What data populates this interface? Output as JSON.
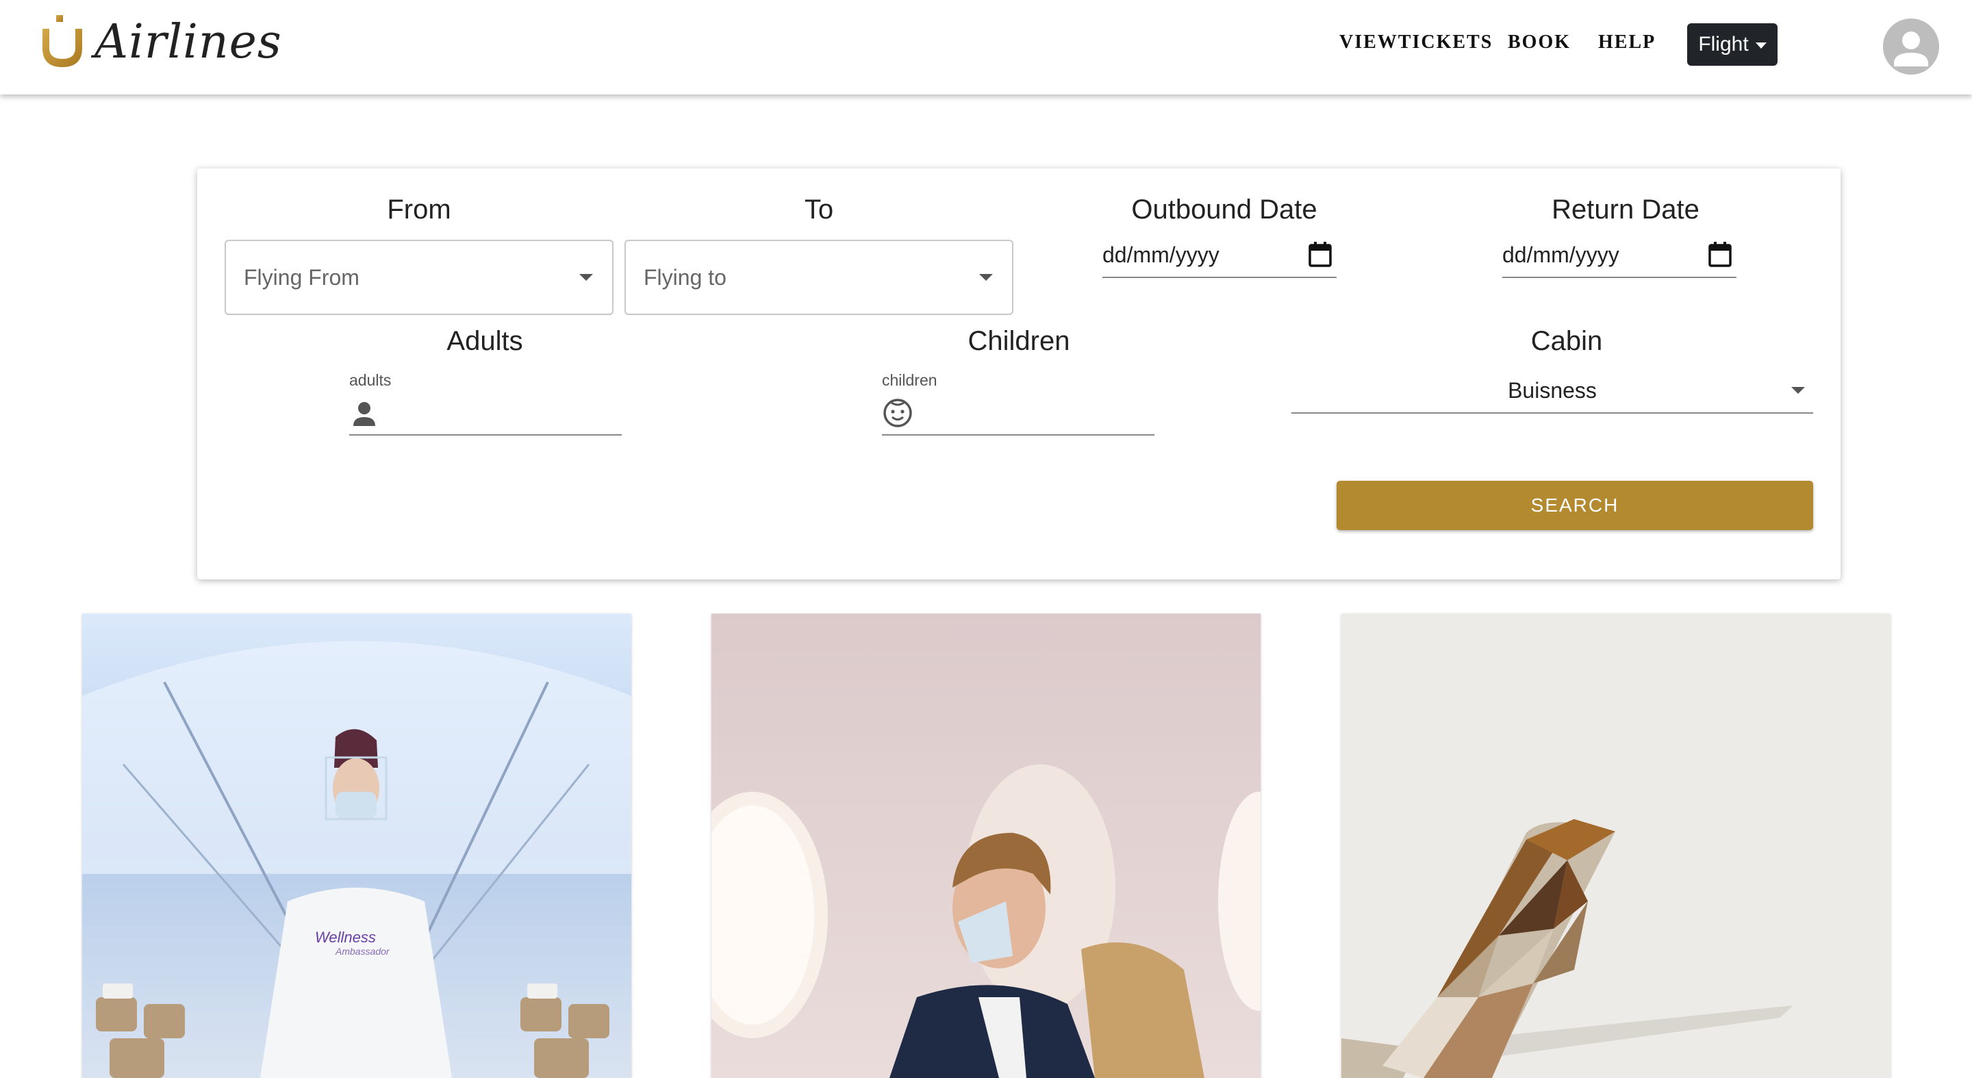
{
  "header": {
    "logo_text": "Airlines",
    "nav": {
      "view_tickets": "VIEWTICKETS",
      "book": "BOOK",
      "help": "HELP"
    },
    "flight_button": "Flight",
    "avatar_icon": "user-account-icon"
  },
  "search": {
    "from": {
      "label": "From",
      "placeholder": "Flying From"
    },
    "to": {
      "label": "To",
      "placeholder": "Flying to"
    },
    "outbound": {
      "label": "Outbound Date",
      "placeholder": "dd/mm/yyyy"
    },
    "return": {
      "label": "Return Date",
      "placeholder": "dd/mm/yyyy"
    },
    "adults": {
      "label": "Adults",
      "field_label": "adults",
      "value": ""
    },
    "children": {
      "label": "Children",
      "field_label": "children",
      "value": ""
    },
    "cabin": {
      "label": "Cabin",
      "value": "Buisness"
    },
    "search_button": "SEARCH"
  },
  "promos": [
    {
      "image": "cabin-crew-wellness-ambassador",
      "badge": "Wellness Ambassador"
    },
    {
      "image": "passenger-with-mask"
    },
    {
      "image": "aircraft-tail"
    }
  ],
  "colors": {
    "accent": "#b38a30",
    "flight_button": "#212529"
  }
}
